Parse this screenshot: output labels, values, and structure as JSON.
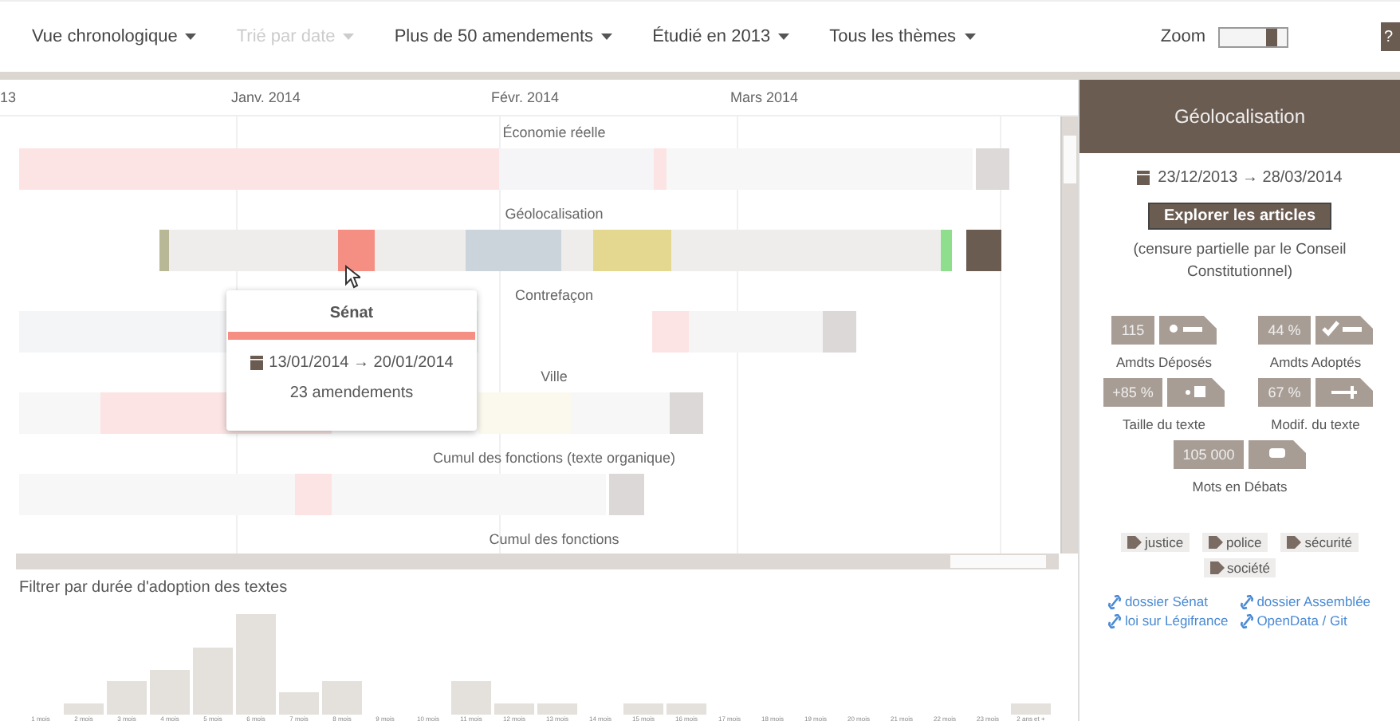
{
  "toolbar": {
    "menus": [
      {
        "label": "Vue chronologique",
        "disabled": false
      },
      {
        "label": "Trié par date",
        "disabled": true
      },
      {
        "label": "Plus de 50 amendements",
        "disabled": false
      },
      {
        "label": "Étudié en 2013",
        "disabled": false
      },
      {
        "label": "Tous les thèmes",
        "disabled": false
      }
    ],
    "zoom": {
      "label": "Zoom",
      "level": 0.85
    },
    "help_button": "?"
  },
  "timeline": {
    "months": [
      "13",
      "Janv. 2014",
      "Févr. 2014",
      "Mars 2014"
    ],
    "rows": [
      {
        "title": "Économie réelle"
      },
      {
        "title": "Géolocalisation"
      },
      {
        "title": "Contrefaçon"
      },
      {
        "title": "Ville"
      },
      {
        "title": "Cumul des fonctions (texte organique)"
      },
      {
        "title": "Cumul des fonctions"
      }
    ]
  },
  "tooltip": {
    "title": "Sénat",
    "dates": "13/01/2014 → 20/01/2014",
    "count": "23 amendements"
  },
  "filter": {
    "title": "Filtrer par durée d'adoption des textes",
    "labels": [
      "1 mois",
      "2 mois",
      "3 mois",
      "4 mois",
      "5 mois",
      "6 mois",
      "7 mois",
      "8 mois",
      "9 mois",
      "10 mois",
      "11 mois",
      "12 mois",
      "13 mois",
      "14 mois",
      "15 mois",
      "16 mois",
      "17 mois",
      "18 mois",
      "19 mois",
      "20 mois",
      "21 mois",
      "22 mois",
      "23 mois",
      "2 ans et +"
    ]
  },
  "panel": {
    "title": "Géolocalisation",
    "dates": "23/12/2013 → 28/03/2014",
    "button": "Explorer les articles",
    "note": "(censure partielle par le Conseil Constitutionnel)",
    "stats": [
      {
        "value": "115",
        "label": "Amdts Déposés",
        "kind": "deposited"
      },
      {
        "value": "44 %",
        "label": "Amdts Adoptés",
        "kind": "adopted"
      },
      {
        "value": "+85 %",
        "label": "Taille du texte",
        "kind": "size"
      },
      {
        "value": "67 %",
        "label": "Modif. du texte",
        "kind": "modified"
      },
      {
        "value": "105 000",
        "label": "Mots en Débats",
        "kind": "words"
      }
    ],
    "tags": [
      "justice",
      "police",
      "sécurité",
      "société"
    ],
    "links": [
      "dossier Sénat",
      "dossier Assemblée",
      "loi sur Légifrance",
      "OpenData / Git"
    ]
  }
}
